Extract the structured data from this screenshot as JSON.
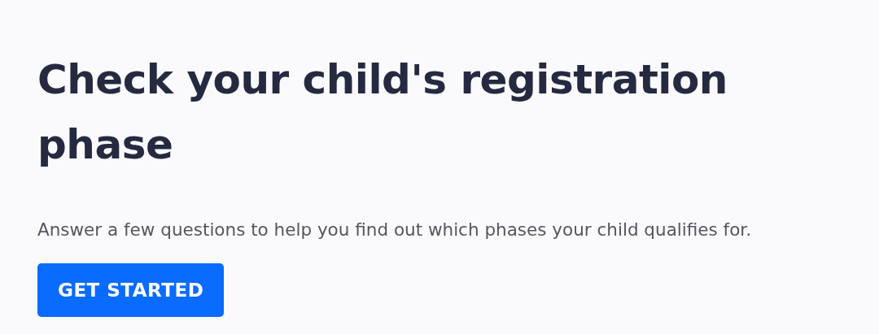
{
  "heading": "Check your child's registration phase",
  "description": "Answer a few questions to help you find out which phases your child qualifies for.",
  "button": {
    "label": "GET STARTED"
  }
}
